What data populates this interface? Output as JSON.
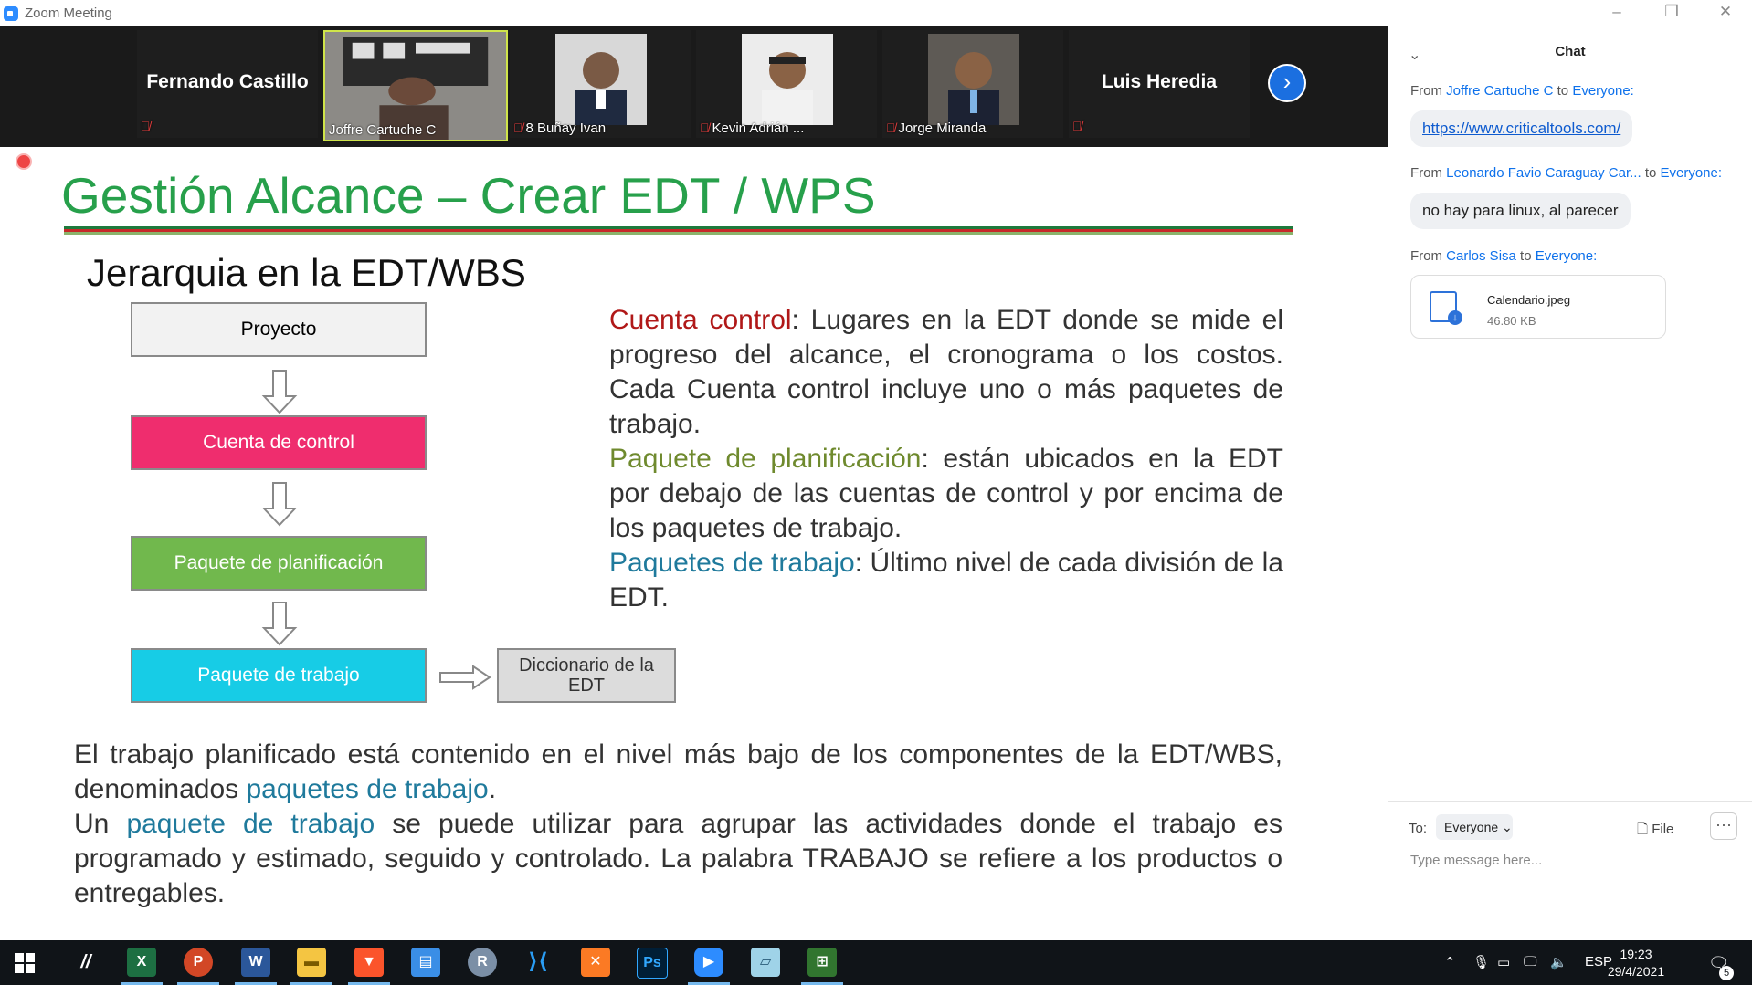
{
  "window": {
    "app_title": "Zoom Meeting",
    "minimize": "–",
    "restore": "❐",
    "close": "✕"
  },
  "gallery": {
    "participants": [
      {
        "name": "Fernando Castillo",
        "video": false
      },
      {
        "name": "Joffre Cartuche C",
        "video": true
      },
      {
        "name": "8 Buñay Ivan",
        "video": true
      },
      {
        "name": "Kevin Adrián ...",
        "video": true
      },
      {
        "name": "Jorge Miranda",
        "video": true
      },
      {
        "name": "Luis Heredia",
        "video": false
      }
    ],
    "next_icon": "›"
  },
  "slide": {
    "title": "Gestión Alcance – Crear EDT / WPS",
    "subtitle": "Jerarquia en la EDT/WBS",
    "boxes": {
      "proyecto": "Proyecto",
      "cuenta": "Cuenta de control",
      "planificacion": "Paquete de planificación",
      "trabajo": "Paquete de trabajo",
      "diccionario": "Diccionario de la EDT"
    },
    "colors": {
      "title": "#27a04b",
      "cuenta": "#ef2d6e",
      "planificacion": "#71b84d",
      "trabajo": "#17cce6",
      "proyecto": "#f2f2f2",
      "diccionario": "#dcdcdc"
    },
    "right": {
      "cuenta_term": "Cuenta control",
      "cuenta_def": ": Lugares en la EDT donde se mide el progreso del alcance, el cronograma o los costos. Cada Cuenta control incluye uno o más paquetes de trabajo.",
      "planif_term": "Paquete de planificación",
      "planif_def": ": están ubicados en la EDT por debajo de las cuentas de control y por encima de los paquetes de trabajo.",
      "trabajo_term": "Paquetes de trabajo",
      "trabajo_def": ": Último nivel de cada división de la EDT."
    },
    "bottom": {
      "p1_a": "El trabajo planificado está contenido en el nivel más bajo de los componentes de la EDT/WBS, denominados ",
      "p1_link": "paquetes de trabajo",
      "p1_b": ".",
      "p2_a": "Un ",
      "p2_link": "paquete de trabajo",
      "p2_b": " se puede utilizar para agrupar las actividades donde el trabajo es programado y estimado, seguido y controlado. La palabra TRABAJO se refiere a los productos o entregables."
    }
  },
  "chat": {
    "title": "Chat",
    "messages": [
      {
        "from_label": "From",
        "sender": "Joffre Cartuche C",
        "to_label": "to",
        "recipient": "Everyone:",
        "text": "https://www.criticaltools.com/"
      },
      {
        "from_label": "From",
        "sender": "Leonardo Favio Caraguay Car...",
        "to_label": "to",
        "recipient": "Everyone:",
        "text": "no hay para linux, al parecer"
      },
      {
        "from_label": "From",
        "sender": "Carlos Sisa",
        "to_label": "to",
        "recipient": "Everyone:",
        "file_name": "Calendario.jpeg",
        "file_size": "46.80 KB"
      }
    ],
    "to_label": "To:",
    "to_value": "Everyone",
    "file_button": "File",
    "more_button": "···",
    "input_placeholder": "Type message here..."
  },
  "taskbar": {
    "apps": [
      "windows-start",
      "metro-app",
      "excel",
      "powerpoint",
      "word",
      "file-explorer",
      "brave",
      "control-panel",
      "r-language",
      "vscode",
      "xampp",
      "photoshop",
      "zoom",
      "notepad",
      "project"
    ],
    "language": "ESP",
    "time": "19:23",
    "date": "29/4/2021",
    "notifications": "5"
  }
}
